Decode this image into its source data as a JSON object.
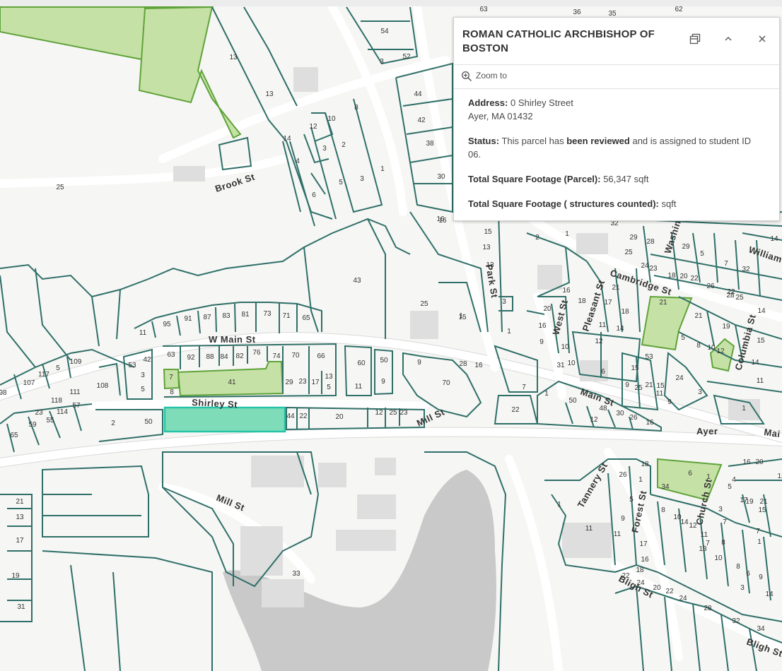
{
  "popup": {
    "title": "ROMAN CATHOLIC ARCHBISHOP OF BOSTON",
    "zoom_to": "Zoom to",
    "address_label": "Address:",
    "address_line1": "0 Shirley Street",
    "address_line2": "Ayer, MA 01432",
    "status_label": "Status:",
    "status_pre": "This parcel has",
    "status_bold": "been reviewed",
    "status_post": "and is assigned to student ID 06.",
    "parcel_sqft_label": "Total Square Footage (Parcel):",
    "parcel_sqft_value": "56,347  sqft",
    "struct_sqft_label": "Total Square Footage ( structures counted):",
    "struct_sqft_value": "sqft",
    "icons": {
      "dock": "dock-icon",
      "collapse": "chevron-up-icon",
      "close": "close-icon",
      "zoom": "zoom-in-icon"
    }
  },
  "colors": {
    "parcel_outline": "#2f6f68",
    "reviewed_fill": "#c6e1a6",
    "selected_fill": "#7fdcb8",
    "water": "#c9c9c9"
  },
  "streets": {
    "brook": "Brook St",
    "w_main": "W Main St",
    "shirley": "Shirley St",
    "mill_upper": "Mill St",
    "mill_lower": "Mill St",
    "park": "Park St",
    "west": "West St",
    "pleasant": "Pleasant St",
    "cambridge": "Cambridge St",
    "main": "Main St",
    "ayer": "Ayer",
    "mai": "Mai",
    "columbia": "Columbia St",
    "washington": "Washin",
    "william": "William",
    "tannery": "Tannery St",
    "forest": "Forest St",
    "church": "Church St",
    "bligh": "Bligh St",
    "bligh2": "Bligh St"
  },
  "parcel_numbers": [
    "63",
    "36",
    "35",
    "62",
    "54",
    "3",
    "52",
    "13",
    "13",
    "44",
    "42",
    "38",
    "30",
    "16",
    "8",
    "12",
    "10",
    "14",
    "3",
    "2",
    "4",
    "1",
    "5",
    "3",
    "6",
    "25",
    "43",
    "25",
    "15",
    "3",
    "1",
    "15",
    "13",
    "13",
    "16",
    "2",
    "1",
    "32",
    "29",
    "28",
    "29",
    "5",
    "7",
    "32",
    "14",
    "25",
    "24",
    "23",
    "18",
    "20",
    "22",
    "26",
    "28",
    "25",
    "14",
    "21",
    "21",
    "22",
    "16",
    "18",
    "21",
    "17",
    "18",
    "20",
    "16",
    "14",
    "11",
    "12",
    "9",
    "10",
    "10",
    "5",
    "8",
    "10",
    "12",
    "14",
    "15",
    "19",
    "24",
    "11",
    "6",
    "31",
    "53",
    "15",
    "9",
    "25",
    "21",
    "15",
    "11",
    "9",
    "3",
    "1",
    "1",
    "50",
    "48",
    "30",
    "26",
    "16",
    "12",
    "7",
    "70",
    "22",
    "9",
    "28",
    "16",
    "1",
    "11",
    "95",
    "91",
    "87",
    "83",
    "81",
    "73",
    "71",
    "65",
    "63",
    "92",
    "88",
    "84",
    "82",
    "76",
    "74",
    "70",
    "66",
    "60",
    "50",
    "42",
    "3",
    "5",
    "7",
    "8",
    "41",
    "29",
    "23",
    "17",
    "13",
    "5",
    "11",
    "9",
    "5",
    "109",
    "107",
    "117",
    "111",
    "108",
    "53",
    "98",
    "23",
    "118",
    "114",
    "57",
    "55",
    "59",
    "65",
    "2",
    "50",
    "44",
    "22",
    "20",
    "12",
    "25",
    "23",
    "21",
    "13",
    "17",
    "19",
    "31",
    "33",
    "1",
    "11",
    "26",
    "18",
    "1",
    "5",
    "9",
    "11",
    "17",
    "16",
    "18",
    "22",
    "24",
    "20",
    "22",
    "24",
    "28",
    "32",
    "34",
    "34",
    "8",
    "10",
    "12",
    "14",
    "11",
    "13",
    "10",
    "8",
    "6",
    "9",
    "7",
    "15",
    "17",
    "19",
    "21",
    "3",
    "7",
    "5",
    "1",
    "6",
    "4",
    "8",
    "7",
    "3",
    "1",
    "14",
    "12",
    "16",
    "20",
    "18",
    "11",
    "21",
    "4",
    "6"
  ]
}
